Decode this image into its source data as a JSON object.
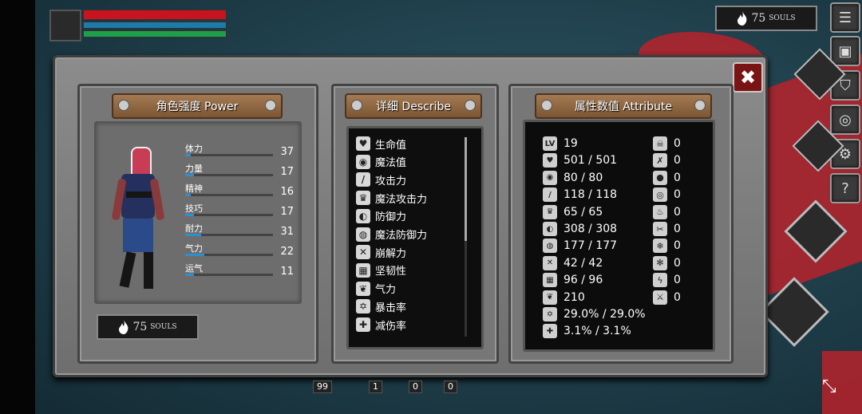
{
  "hud": {
    "health_color": "#c8141e",
    "mana_color": "#1e7aa8",
    "stamina_color": "#1ea04a",
    "souls_value": "75",
    "souls_unit": "SOULS"
  },
  "side_buttons": {
    "menu": "list-icon",
    "inventory": "bag-icon",
    "skill": "helmet-icon",
    "shop": "coin-icon",
    "settings": "gear-icon",
    "help": "?"
  },
  "close_label": "✖",
  "power": {
    "title": "角色强度 Power",
    "stats": [
      {
        "label": "体力",
        "value": "37",
        "fill": 0.06
      },
      {
        "label": "力量",
        "value": "17",
        "fill": 0.1
      },
      {
        "label": "精神",
        "value": "16",
        "fill": 0.06
      },
      {
        "label": "技巧",
        "value": "17",
        "fill": 0.1
      },
      {
        "label": "耐力",
        "value": "31",
        "fill": 0.18
      },
      {
        "label": "气力",
        "value": "22",
        "fill": 0.22
      },
      {
        "label": "运气",
        "value": "11",
        "fill": 0.1
      }
    ],
    "souls_value": "75",
    "souls_unit": "SOULS"
  },
  "describe": {
    "title": "详细 Describe",
    "items": [
      {
        "icon": "heart-icon",
        "glyph": "♥",
        "label": "生命值"
      },
      {
        "icon": "mana-icon",
        "glyph": "◉",
        "label": "魔法值"
      },
      {
        "icon": "sword-icon",
        "glyph": "/",
        "label": "攻击力"
      },
      {
        "icon": "magic-attack-icon",
        "glyph": "♛",
        "label": "魔法攻击力"
      },
      {
        "icon": "shield-icon",
        "glyph": "◐",
        "label": "防御力"
      },
      {
        "icon": "magic-shield-icon",
        "glyph": "◍",
        "label": "魔法防御力"
      },
      {
        "icon": "break-icon",
        "glyph": "✕",
        "label": "崩解力"
      },
      {
        "icon": "toughness-icon",
        "glyph": "▦",
        "label": "坚韧性"
      },
      {
        "icon": "lungs-icon",
        "glyph": "❦",
        "label": "气力"
      },
      {
        "icon": "crit-icon",
        "glyph": "✡",
        "label": "暴击率"
      },
      {
        "icon": "damage-reduction-icon",
        "glyph": "✚",
        "label": "减伤率"
      }
    ]
  },
  "attribute": {
    "title": "属性数值 Attribute",
    "values": [
      {
        "icon": "level-icon",
        "glyph": "LV",
        "value": "19"
      },
      {
        "icon": "heart-icon",
        "glyph": "♥",
        "value": "501 / 501"
      },
      {
        "icon": "mana-icon",
        "glyph": "◉",
        "value": "80 / 80"
      },
      {
        "icon": "sword-icon",
        "glyph": "/",
        "value": "118 / 118"
      },
      {
        "icon": "magic-attack-icon",
        "glyph": "♛",
        "value": "65 / 65"
      },
      {
        "icon": "shield-icon",
        "glyph": "◐",
        "value": "308 / 308"
      },
      {
        "icon": "magic-shield-icon",
        "glyph": "◍",
        "value": "177 / 177"
      },
      {
        "icon": "break-icon",
        "glyph": "✕",
        "value": "42 / 42"
      },
      {
        "icon": "toughness-icon",
        "glyph": "▦",
        "value": "96 / 96"
      },
      {
        "icon": "lungs-icon",
        "glyph": "❦",
        "value": "210"
      },
      {
        "icon": "crit-icon",
        "glyph": "✡",
        "value": "29.0% / 29.0%"
      },
      {
        "icon": "damage-reduction-icon",
        "glyph": "✚",
        "value": "3.1% / 3.1%"
      }
    ],
    "resistances": [
      {
        "icon": "skull-icon",
        "glyph": "☠",
        "value": "0"
      },
      {
        "icon": "bone-icon",
        "glyph": "✗",
        "value": "0"
      },
      {
        "icon": "drop-icon",
        "glyph": "●",
        "value": "0"
      },
      {
        "icon": "poison-icon",
        "glyph": "◎",
        "value": "0"
      },
      {
        "icon": "fire-icon",
        "glyph": "♨",
        "value": "0"
      },
      {
        "icon": "bleed-icon",
        "glyph": "✂",
        "value": "0"
      },
      {
        "icon": "frost-icon",
        "glyph": "❄",
        "value": "0"
      },
      {
        "icon": "ice-icon",
        "glyph": "✻",
        "value": "0"
      },
      {
        "icon": "lightning-icon",
        "glyph": "ϟ",
        "value": "0"
      },
      {
        "icon": "pierce-icon",
        "glyph": "⚔",
        "value": "0"
      }
    ]
  },
  "bottom_bar": [
    {
      "value": "99"
    },
    {
      "value": "1"
    },
    {
      "value": "0"
    },
    {
      "value": "0"
    }
  ]
}
